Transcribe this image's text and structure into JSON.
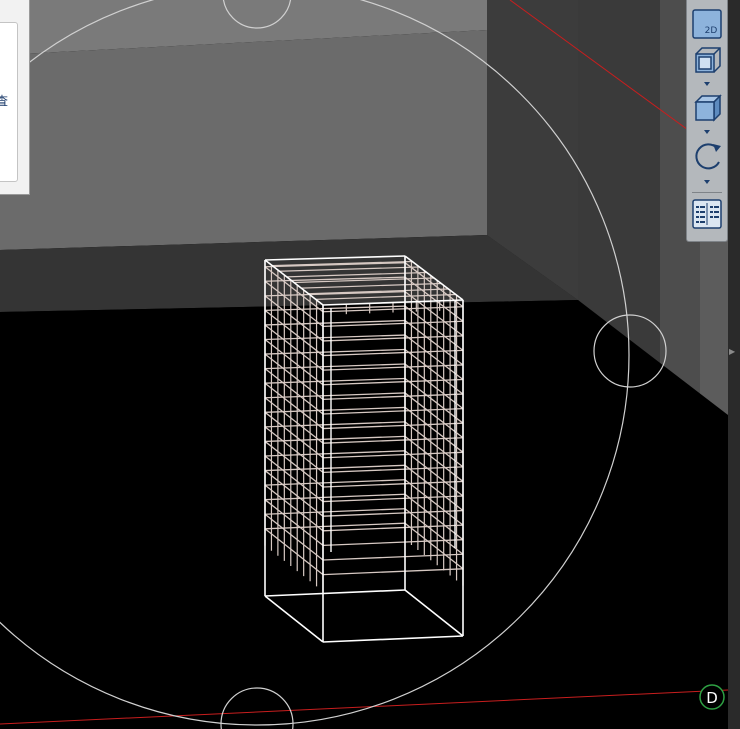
{
  "panel": {
    "partial_text": "査"
  },
  "toolbar": {
    "btn_2d_label": "2D",
    "buttons": [
      {
        "name": "view-2d-button",
        "icon": "view-2d-icon"
      },
      {
        "name": "view-cube-button",
        "icon": "cube-wireframe-icon"
      },
      {
        "name": "view-solid-button",
        "icon": "cube-solid-icon"
      },
      {
        "name": "orbit-button",
        "icon": "rotate-icon"
      },
      {
        "name": "display-settings-button",
        "icon": "list-settings-icon"
      }
    ]
  },
  "compass": {
    "label": "D"
  },
  "colors": {
    "scene_bg": "#000000",
    "wall": "#5a5a5a",
    "cage": "#d7c9c3",
    "cage_front": "#ffffff",
    "orbit_ring": "#d0d0d0",
    "axis": "#c81e1e",
    "compass": "#2ea043"
  }
}
